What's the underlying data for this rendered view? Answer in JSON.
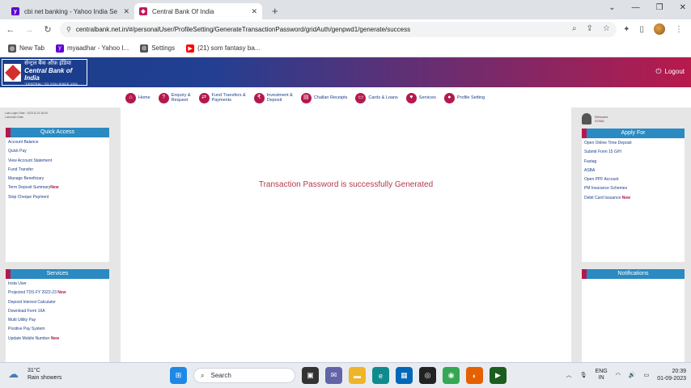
{
  "browser": {
    "tabs": [
      {
        "title": "cbi net banking - Yahoo India Se",
        "icon": "yahoo-icon",
        "color": "#5f01d1",
        "active": false
      },
      {
        "title": "Central Bank Of India",
        "icon": "cbi-icon",
        "color": "#c2185b",
        "active": true
      }
    ],
    "url": "centralbank.net.in/#/personalUser/ProfileSetting/GenerateTransactionPassword/gridAuth/genpwd1/generate/success",
    "bookmarks": [
      {
        "label": "New Tab",
        "icon": "globe-icon",
        "color": "#555555"
      },
      {
        "label": "myaadhar - Yahoo I...",
        "icon": "yahoo-icon",
        "color": "#5f01d1"
      },
      {
        "label": "Settings",
        "icon": "gear-icon",
        "color": "#555555"
      },
      {
        "label": "(21) som fantasy ba...",
        "icon": "youtube-icon",
        "color": "#ff0000"
      }
    ]
  },
  "bank": {
    "logo_hindi": "सेन्ट्रल बैंक ऑफ़ इंडिया",
    "logo_english": "Central Bank of India",
    "logo_tagline": "\"CENTRAL\" TO YOU SINCE 1911",
    "logout": "Logout",
    "menu": [
      {
        "label": "Home",
        "icon": "home-icon"
      },
      {
        "label": "Enquiry &\nRequest",
        "icon": "enquiry-icon"
      },
      {
        "label": "Fund Transfers &\nPayments",
        "icon": "transfer-icon"
      },
      {
        "label": "Investment &\nDeposit",
        "icon": "investment-icon"
      },
      {
        "label": "Challan Receipts",
        "icon": "receipt-icon"
      },
      {
        "label": "Cards & Loans",
        "icon": "cards-icon"
      },
      {
        "label": "Services",
        "icon": "services-icon"
      },
      {
        "label": "Profile Setting",
        "icon": "profile-icon"
      }
    ],
    "last_login": [
      "Last Login Date : 2023-8-23 16:00",
      "Last Actn Date"
    ],
    "quick_access": {
      "title": "Quick Access",
      "items": [
        {
          "label": "Account Balance",
          "new": ""
        },
        {
          "label": "Quick Pay",
          "new": ""
        },
        {
          "label": "View Account Statement",
          "new": ""
        },
        {
          "label": "Fund Transfer",
          "new": ""
        },
        {
          "label": "Manage Beneficiary",
          "new": ""
        },
        {
          "label": "Term Deposit Summary",
          "new": "New"
        },
        {
          "label": "Stop Cheque Payment",
          "new": ""
        }
      ]
    },
    "services": {
      "title": "Services",
      "items": [
        {
          "label": "Insta User",
          "new": ""
        },
        {
          "label": "Projected TDS FY 2022-23",
          "new": "New"
        },
        {
          "label": "Deposit Interest Calculator",
          "new": ""
        },
        {
          "label": "Download Form 16A",
          "new": ""
        },
        {
          "label": "Multi Utility Pay",
          "new": ""
        },
        {
          "label": "Positive Pay System",
          "new": ""
        },
        {
          "label": "Update Mobile Number",
          "new": "New"
        }
      ]
    },
    "user": {
      "greeting": "Welcome",
      "name": "SOMA"
    },
    "apply_for": {
      "title": "Apply For",
      "items": [
        {
          "label": "Open Online Time Deposit",
          "new": ""
        },
        {
          "label": "Submit Form 15 G/H",
          "new": ""
        },
        {
          "label": "Fastag",
          "new": ""
        },
        {
          "label": "ASBA",
          "new": ""
        },
        {
          "label": "Open PPF Account",
          "new": ""
        },
        {
          "label": "PM Insurance Schemes",
          "new": ""
        },
        {
          "label": "Debit Card Issuance",
          "new": "New"
        }
      ]
    },
    "notifications": {
      "title": "Notifications"
    },
    "message": "Transaction Password is successfully Generated"
  },
  "taskbar": {
    "weather_temp": "31°C",
    "weather_desc": "Rain showers",
    "search": "Search",
    "lang1": "ENG",
    "lang2": "IN",
    "time": "20:39",
    "date": "01-09-2023"
  }
}
